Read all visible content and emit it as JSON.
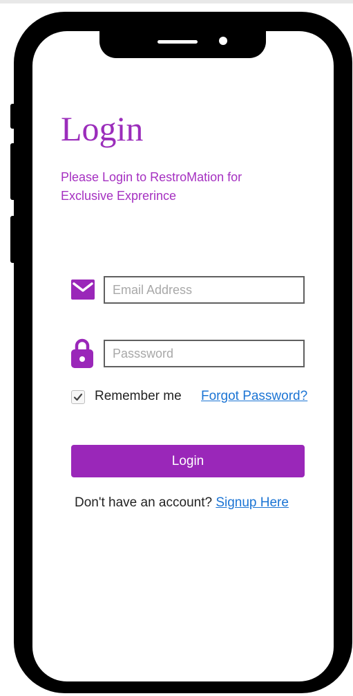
{
  "login": {
    "title": "Login",
    "subtitle": "Please Login to RestroMation for Exclusive Exprerince",
    "email_placeholder": "Email Address",
    "password_placeholder": "Passsword",
    "remember_label": "Remember me",
    "remember_checked": true,
    "forgot_link": "Forgot Password?",
    "login_button": "Login",
    "signup_prompt": "Don't have an account?",
    "signup_link": "Signup Here"
  },
  "colors": {
    "accent": "#9a27b9",
    "link": "#1b74d4"
  },
  "icons": {
    "email": "mail-icon",
    "password": "lock-icon",
    "checkbox": "checkmark-icon"
  }
}
